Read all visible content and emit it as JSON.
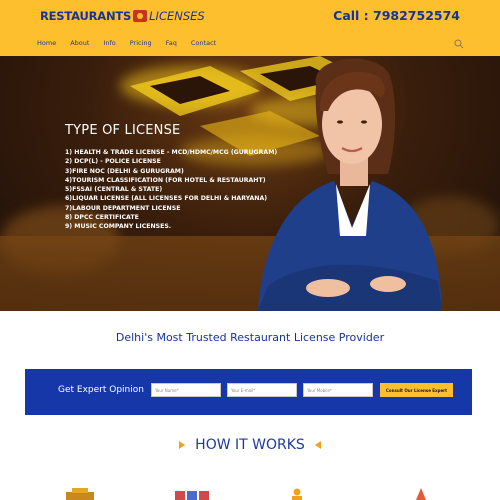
{
  "header": {
    "logo_main": "RESTAURANTS",
    "logo_sub": "LICENSES",
    "call": "Call : 7982752574",
    "nav": [
      "Home",
      "About",
      "Info",
      "Pricing",
      "Faq",
      "Contact"
    ],
    "active_nav": "Home"
  },
  "hero": {
    "title": "TYPE OF LICENSE",
    "licenses": [
      "1) HEALTH & TRADE LICENSE - MCD/HDMC/MCG (GURUGRAM)",
      "2) DCP(L) - POLICE LICENSE",
      "3)FIRE NOC (DELHI & GURUGRAM)",
      "4)TOURISM CLASSIFICATION (FOR HOTEL & RESTAURAHT)",
      "5)FSSAI (CENTRAL & STATE)",
      "6)LIQUAR LICENSE (ALL LICENSES FOR DELHI & HARYANA)",
      "7)LABOUR DEPARTMENT LICENSE",
      "8) DPCC CERTIFICATE",
      "9) MUSIC COMPANY LICENSES."
    ]
  },
  "tagline": "Delhi's Most Trusted Restaurant License Provider",
  "form": {
    "title": "Get Expert Opinion",
    "name_placeholder": "Your Name*",
    "email_placeholder": "Your E-mail*",
    "mobile_placeholder": "Your Mobile*",
    "button": "Consult Our License Expert"
  },
  "how_it_works": {
    "title": "HOW IT WORKS"
  },
  "colors": {
    "header_bg": "#fdbf2d",
    "brand_blue": "#16339a",
    "form_bg": "#1637a8",
    "accent_orange": "#f2a11c"
  },
  "icons": [
    "search-icon",
    "step-shop-icon",
    "step-document-icon",
    "step-person-icon",
    "step-rocket-icon"
  ]
}
